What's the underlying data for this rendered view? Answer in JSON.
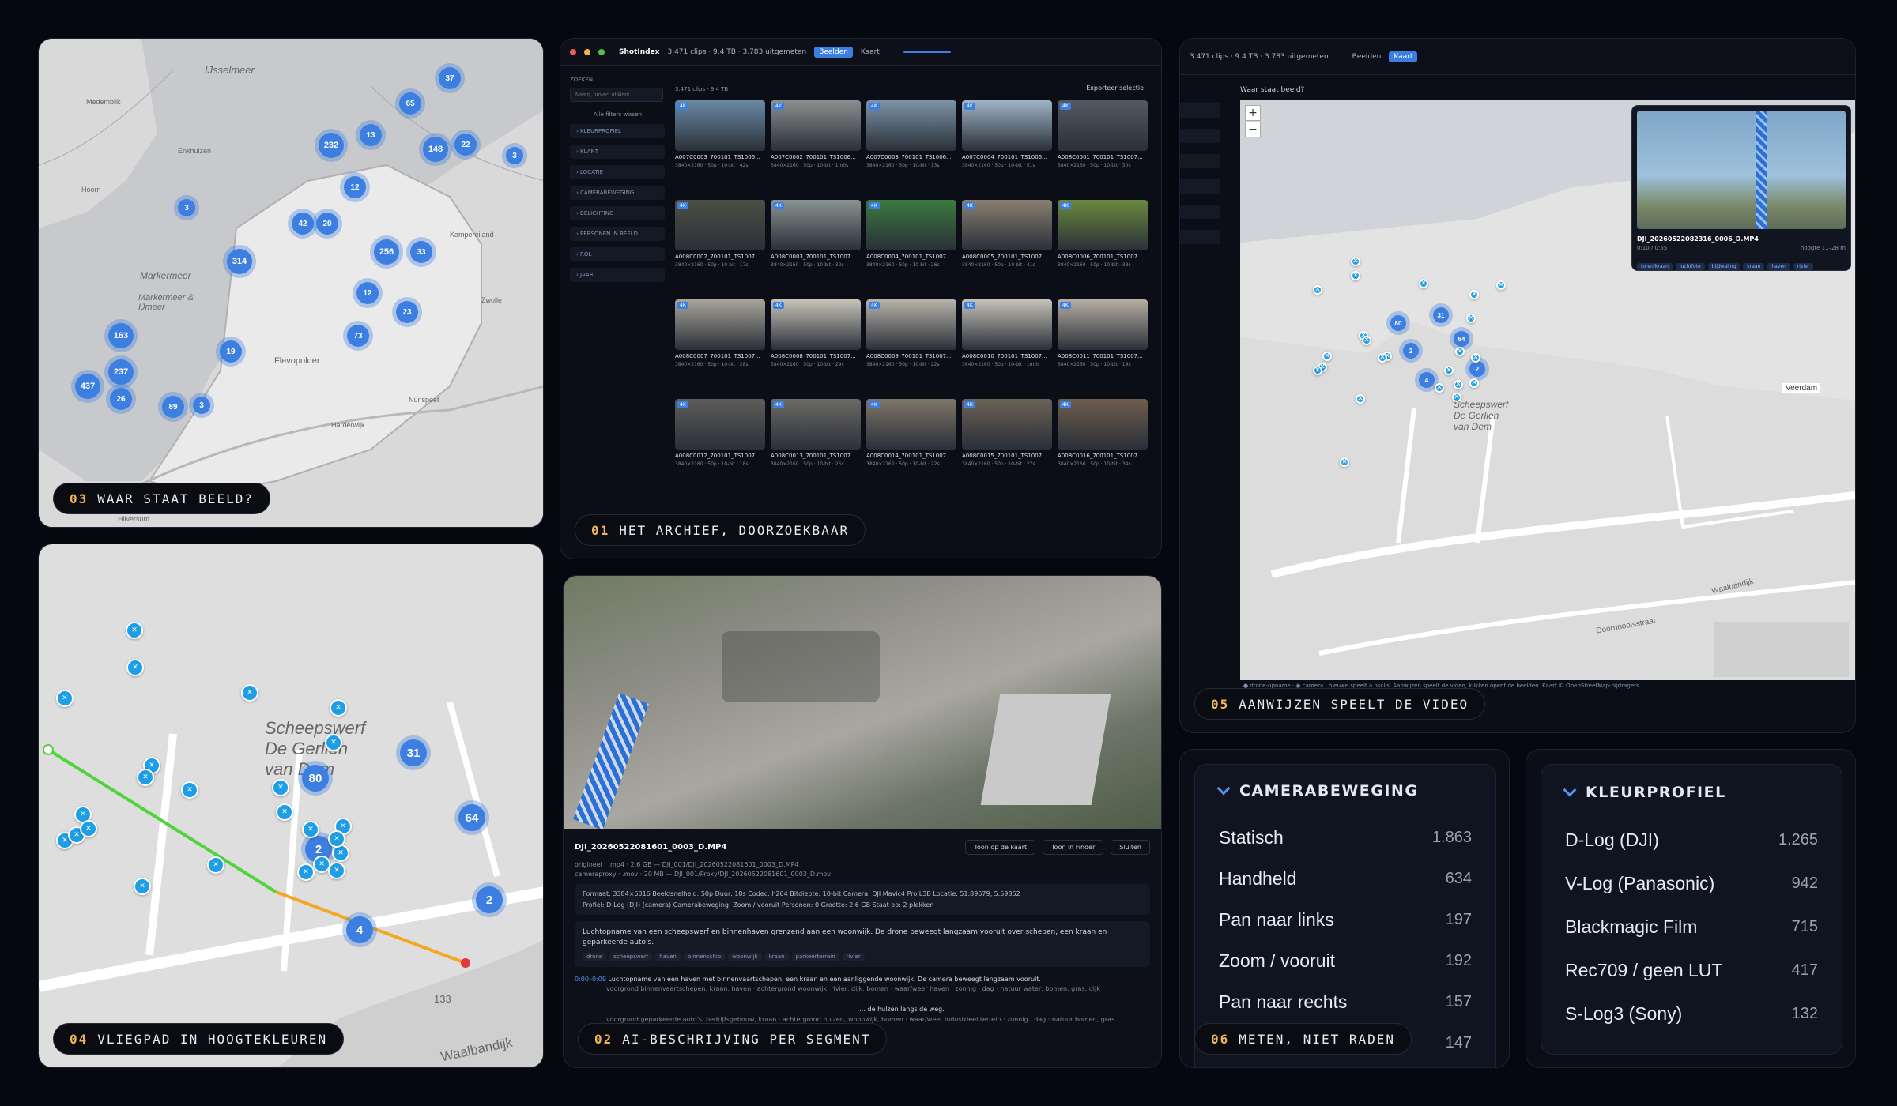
{
  "captions": {
    "p1": {
      "num": "01",
      "text": "HET ARCHIEF, DOORZOEKBAAR"
    },
    "p2": {
      "num": "02",
      "text": "AI-BESCHRIJVING PER SEGMENT"
    },
    "p3": {
      "num": "03",
      "text": "WAAR STAAT BEELD?"
    },
    "p4": {
      "num": "04",
      "text": "VLIEGPAD IN HOOGTEKLEUREN"
    },
    "p5": {
      "num": "05",
      "text": "AANWIJZEN SPEELT DE VIDEO"
    },
    "p6": {
      "num": "06",
      "text": "METEN, NIET RADEN"
    }
  },
  "clusters_map": [
    {
      "label": "37"
    },
    {
      "label": "65"
    },
    {
      "label": "13"
    },
    {
      "label": "232"
    },
    {
      "label": "148"
    },
    {
      "label": "22"
    },
    {
      "label": "3"
    },
    {
      "label": "12"
    },
    {
      "label": "3"
    },
    {
      "label": "42"
    },
    {
      "label": "20"
    },
    {
      "label": "256"
    },
    {
      "label": "33"
    },
    {
      "label": "314"
    },
    {
      "label": "12"
    },
    {
      "label": "23"
    },
    {
      "label": "73"
    },
    {
      "label": "163"
    },
    {
      "label": "19"
    },
    {
      "label": "237"
    },
    {
      "label": "437"
    },
    {
      "label": "26"
    },
    {
      "label": "89"
    },
    {
      "label": "3"
    }
  ],
  "map3_labels": {
    "ijsselmeer": "IJsselmeer",
    "markermeer": "Markermeer",
    "markermeer2": "Markermeer & IJmeer",
    "flevopolder": "Flevopolder",
    "medemblik": "Medemblik",
    "enkhuizen": "Enkhuizen",
    "hoorn": "Hoorn",
    "kampereiland": "Kampereiland",
    "hilversum": "Hilversum",
    "harderwijk": "Harderwijk",
    "nunspeet": "Nunspeet",
    "zwolle": "Zwolle"
  },
  "map4": {
    "place": "Scheepswerf De Gerlien van Dem",
    "clusters": [
      {
        "label": "80"
      },
      {
        "label": "31"
      },
      {
        "label": "2"
      },
      {
        "label": "64"
      },
      {
        "label": "2"
      },
      {
        "label": "4"
      }
    ],
    "road": "Waalbandijk",
    "house_no": "133"
  },
  "archive": {
    "app": "ShotIndex",
    "stats": "3.471 clips · 9.4 TB · 3.783 uitgemeten",
    "tab_grid": "Beelden",
    "tab_map": "Kaart",
    "search_label": "ZOEKEN",
    "search_placeholder": "Naam, project of klant",
    "filters_reset": "Alle filters wissen",
    "export": "Exporteer selectie",
    "count": "3.471 clips · 9.4 TB",
    "facets": [
      "KLEURPROFIEL",
      "KLANT",
      "LOCATIE",
      "CAMERABEWEGING",
      "BELICHTING",
      "PERSONEN IN BEELD",
      "ROL",
      "JAAR"
    ],
    "thumbs": [
      {
        "name": "A007C0003_700101_TS1006...",
        "meta": "3840×2160 · 50p · 10-bit · 42s"
      },
      {
        "name": "A007C0002_700101_TS1006...",
        "meta": "3840×2160 · 50p · 10-bit · 1m0s"
      },
      {
        "name": "A007C0003_700101_TS1006...",
        "meta": "3840×2160 · 50p · 10-bit · 13s"
      },
      {
        "name": "A007C0004_700101_TS1006...",
        "meta": "3840×2160 · 50p · 10-bit · 51s"
      },
      {
        "name": "A008C0001_700101_TS1007...",
        "meta": "3840×2160 · 50p · 10-bit · 30s"
      },
      {
        "name": "A008C0002_700101_TS1007...",
        "meta": "3840×2160 · 50p · 10-bit · 17s"
      },
      {
        "name": "A008C0003_700101_TS1007...",
        "meta": "3840×2160 · 50p · 10-bit · 32s"
      },
      {
        "name": "A008C0004_700101_TS1007...",
        "meta": "3840×2160 · 50p · 10-bit · 26s"
      },
      {
        "name": "A008C0005_700101_TS1007...",
        "meta": "3840×2160 · 50p · 10-bit · 41s"
      },
      {
        "name": "A008C0006_700101_TS1007...",
        "meta": "3840×2160 · 50p · 10-bit · 38s"
      },
      {
        "name": "A008C0007_700101_TS1007...",
        "meta": "3840×2160 · 50p · 10-bit · 28s"
      },
      {
        "name": "A008C0008_700101_TS1007...",
        "meta": "3840×2160 · 50p · 10-bit · 29s"
      },
      {
        "name": "A008C0009_700101_TS1007...",
        "meta": "3840×2160 · 50p · 10-bit · 22s"
      },
      {
        "name": "A008C0010_700101_TS1007...",
        "meta": "3840×2160 · 50p · 10-bit · 1m0s"
      },
      {
        "name": "A008C0011_700101_TS1007...",
        "meta": "3840×2160 · 50p · 10-bit · 19s"
      },
      {
        "name": "A008C0012_700101_TS1007...",
        "meta": "3840×2160 · 50p · 10-bit · 18s"
      },
      {
        "name": "A008C0013_700101_TS1007...",
        "meta": "3840×2160 · 50p · 10-bit · 25s"
      },
      {
        "name": "A008C0014_700101_TS1007...",
        "meta": "3840×2160 · 50p · 10-bit · 22s"
      },
      {
        "name": "A008C0015_700101_TS1007...",
        "meta": "3840×2160 · 50p · 10-bit · 27s"
      },
      {
        "name": "A008C0016_700101_TS1007...",
        "meta": "3840×2160 · 50p · 10-bit · 34s"
      }
    ]
  },
  "ai": {
    "filename": "DJI_20260522081601_0003_D.MP4",
    "btn_map": "Toon op de kaart",
    "btn_finder": "Toon in Finder",
    "btn_close": "Sluiten",
    "path1": "origineel · .mp4 · 2.6 GB — DJI_001/DJI_20260522081601_0003_D.MP4",
    "path2": "cameraproxy · .mov · 20 MB — DJI_001/Proxy/DJI_20260522081601_0003_D.mov",
    "specs1": "Formaat: 3384×6016   Beeldsnelheid: 50p   Duur: 18s   Codec: h264   Bitdiepte: 10-bit   Camera: DJI Mavic4 Pro L3B   Locatie: 51.89679, 5.59852",
    "specs2": "Profiel: D-Log (DJI) (camera)   Camerabeweging: Zoom / vooruit   Personen: 0   Grootte: 2.6 GB   Staat op: 2 plekken",
    "summary": "Luchtopname van een scheepswerf en binnenhaven grenzend aan een woonwijk. De drone beweegt langzaam vooruit over schepen, een kraan en geparkeerde auto's.",
    "tags": [
      "drone",
      "scheepswerf",
      "haven",
      "binnenschip",
      "woonwijk",
      "kraan",
      "parkeerterrein",
      "rivier"
    ],
    "seg_time": "0:00–0:09",
    "seg_text": "Luchtopname van een haven met binnenvaartschepen, een kraan en een aanliggende woonwijk. De camera beweegt langzaam vooruit.",
    "seg_line": "voorgrond binnenvaartschepen, kraan, haven · achtergrond woonwijk, rivier, dijk, bomen · waar/weer haven · zonnig · dag · natuur water, bomen, gras, dijk",
    "seg2_text": "… de hulzen langs de weg.",
    "seg2_line": "voorgrond geparkeerde auto's, bedrijfsgebouw, kraan · achtergrond huizen, woonwijk, bomen · waar/weer industrieel terrein · zonnig · dag · natuur bomen, gras"
  },
  "video_map": {
    "stats": "3.471 clips · 9.4 TB · 3.783 uitgemeten",
    "tab_grid": "Beelden",
    "tab_map": "Kaart",
    "question": "Waar staat beeld?",
    "popup_file": "DJI_20260522082316_0006_D.MP4",
    "popup_time": "0:10 / 0:55",
    "popup_height": "hoogte 11–28 m",
    "popup_tags": [
      "toren/kraan",
      "luchtfoto",
      "bijdwaling",
      "kraan",
      "haven",
      "rivier"
    ],
    "place": "Scheepswerf De Gerlien van Dem",
    "veerdam": "Veerdam",
    "road1": "Waalbandijk",
    "road2": "Doornnooisstraat",
    "clusters": [
      {
        "label": "80"
      },
      {
        "label": "31"
      },
      {
        "label": "2"
      },
      {
        "label": "64"
      },
      {
        "label": "4"
      },
      {
        "label": "2"
      }
    ],
    "footer": "● drone-opname · ◉ camera · hieuwe speelt a nsclls. Aanwijzen speelt de video, klikken opent de beelden. Kaart © OpenStreetMap-bijdragers.",
    "attribution": "Leaflet | © OpenStreetMap"
  },
  "camera_stats": {
    "title": "CAMERABEWEGING",
    "rows": [
      {
        "label": "Statisch",
        "value": "1.863"
      },
      {
        "label": "Handheld",
        "value": "634"
      },
      {
        "label": "Pan naar links",
        "value": "197"
      },
      {
        "label": "Zoom / vooruit",
        "value": "192"
      },
      {
        "label": "Pan naar rechts",
        "value": "157"
      },
      {
        "label": "",
        "value": "147"
      }
    ]
  },
  "color_stats": {
    "title": "KLEURPROFIEL",
    "rows": [
      {
        "label": "D-Log (DJI)",
        "value": "1.265"
      },
      {
        "label": "V-Log (Panasonic)",
        "value": "942"
      },
      {
        "label": "Blackmagic Film",
        "value": "715"
      },
      {
        "label": "Rec709 / geen LUT",
        "value": "417"
      },
      {
        "label": "S-Log3 (Sony)",
        "value": "132"
      }
    ]
  },
  "colors": {
    "accent": "#3d7fe0",
    "marker": "#1e9ee6",
    "caption_num": "#f0b45a"
  }
}
